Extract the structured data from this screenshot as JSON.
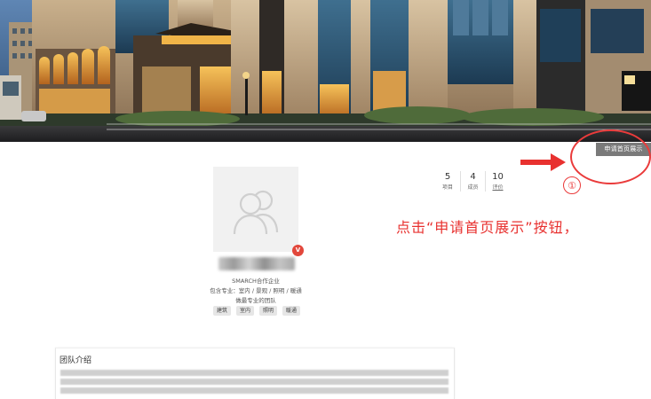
{
  "banner": {
    "apply_button_label": "申请首页展示"
  },
  "annotation": {
    "step_number": "①",
    "instruction": "点击“申请首页展示”按钮，",
    "color": "#ea3b3b"
  },
  "profile": {
    "avatar_icon": "default-team-avatar-icon",
    "verified_badge": "V",
    "team_name": "",
    "team_type": "SMARCH合作企业",
    "specialty": "包含专业：室内 / 景观 / 照明 / 暖通",
    "slogan": "做最专业的团队",
    "tags": [
      "建筑",
      "室内",
      "照明",
      "暖通"
    ]
  },
  "stats": [
    {
      "value": "5",
      "label": "项目"
    },
    {
      "value": "4",
      "label": "成员"
    },
    {
      "value": "10",
      "label": "评价"
    }
  ],
  "intro": {
    "title": "团队介绍"
  }
}
